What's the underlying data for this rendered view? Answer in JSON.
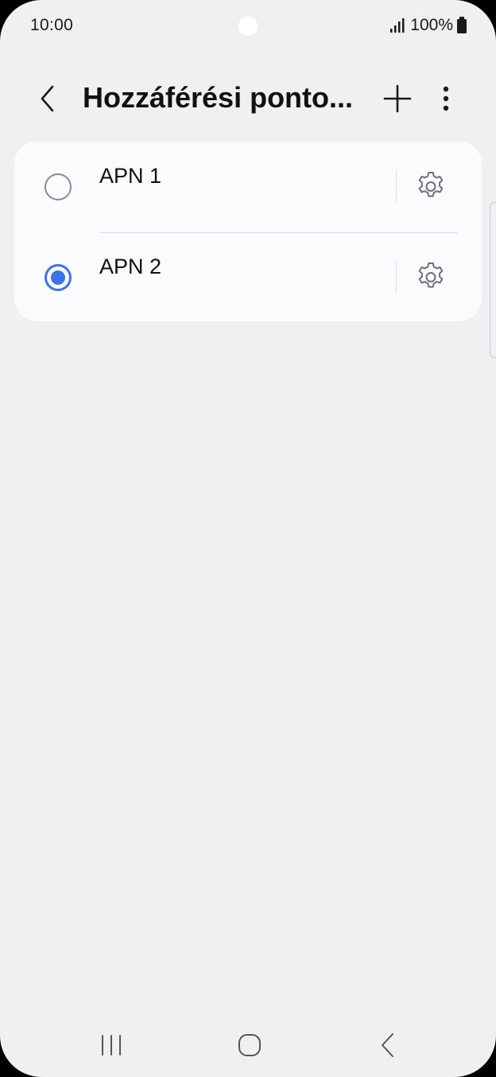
{
  "status_bar": {
    "time": "10:00",
    "battery_text": "100%"
  },
  "header": {
    "title": "Hozzáférési ponto..."
  },
  "apn_list": [
    {
      "label": "APN 1",
      "selected": false
    },
    {
      "label": "APN 2",
      "selected": true
    }
  ],
  "colors": {
    "accent": "#3a75e6",
    "background": "#f0f0f2",
    "card": "#fbfbfd"
  },
  "icons": {
    "back": "chevron-left-icon",
    "add": "plus-icon",
    "more": "more-vertical-icon",
    "settings": "gear-icon",
    "nav_recents": "recents-icon",
    "nav_home": "home-icon",
    "nav_back": "back-icon"
  }
}
